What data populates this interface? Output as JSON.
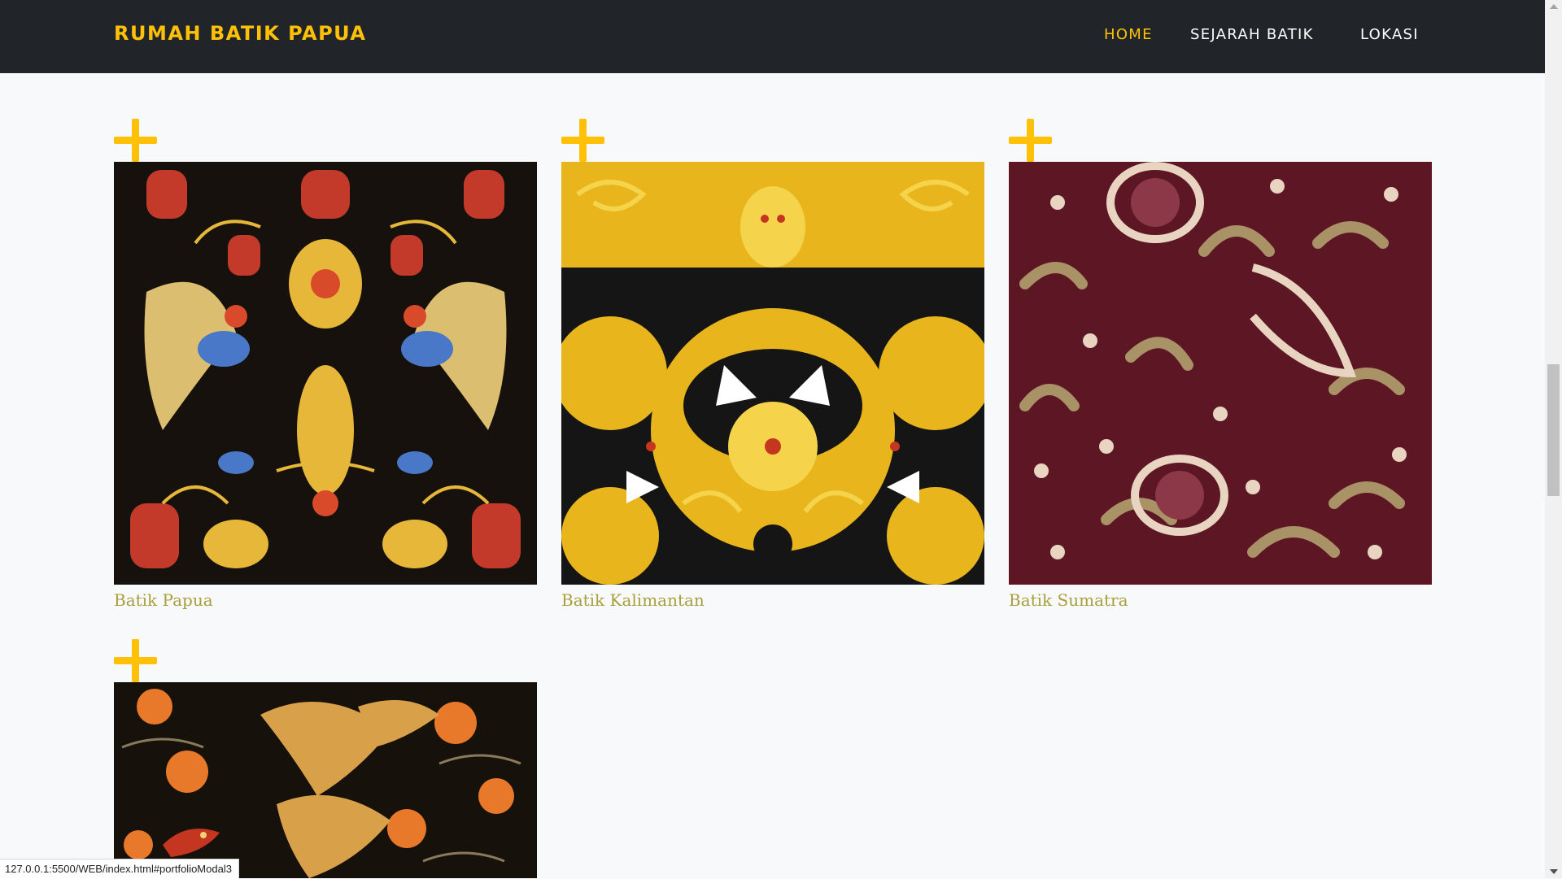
{
  "navbar": {
    "brand": "RUMAH BATIK PAPUA",
    "links": [
      {
        "label": "HOME",
        "active": true
      },
      {
        "label": "SEJARAH BATIK",
        "active": false
      },
      {
        "label": "LOKASI",
        "active": false
      }
    ]
  },
  "portfolio": {
    "items": [
      {
        "caption": "Batik Papua",
        "overlay_icon": "plus-icon"
      },
      {
        "caption": "Batik Kalimantan",
        "overlay_icon": "plus-icon"
      },
      {
        "caption": "Batik Sumatra",
        "overlay_icon": "plus-icon"
      },
      {
        "caption": "",
        "overlay_icon": "plus-icon"
      }
    ]
  },
  "status_bar": {
    "url": "127.0.0.1:5500/WEB/index.html#portfolioModal3"
  },
  "colors": {
    "navbar_bg": "#212529",
    "accent": "#ffc107",
    "caption": "#a89f3c",
    "page_bg": "#f8f9fa"
  }
}
